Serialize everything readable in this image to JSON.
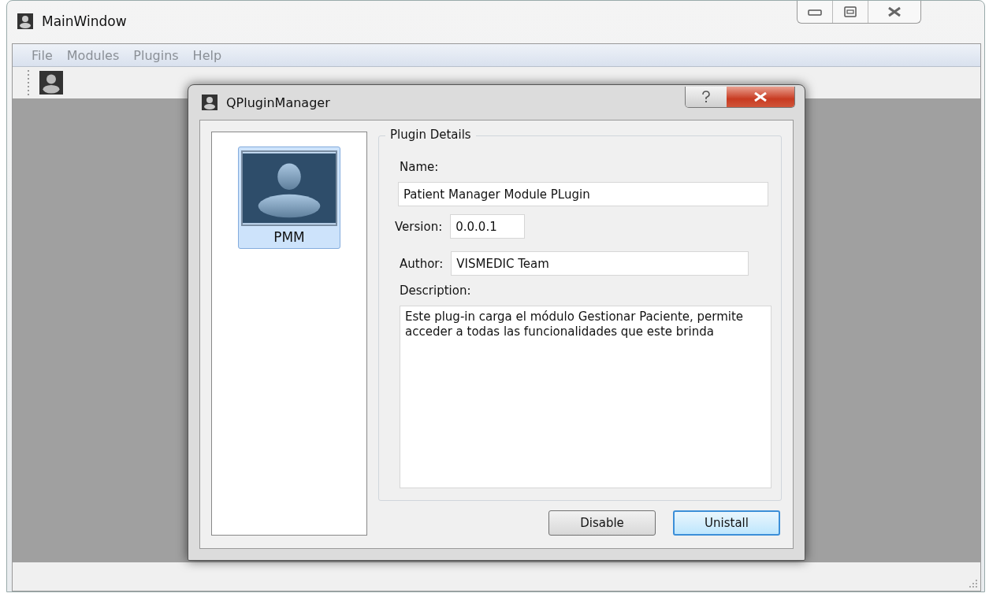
{
  "window": {
    "title": "MainWindow"
  },
  "menu": [
    "File",
    "Modules",
    "Plugins",
    "Help"
  ],
  "dialog": {
    "title": "QPluginManager",
    "plugins": [
      {
        "label": "PMM",
        "selected": true
      }
    ],
    "details": {
      "title": "Plugin Details",
      "name_label": "Name:",
      "name": "Patient Manager Module PLugin",
      "version_label": "Version:",
      "version": "0.0.0.1",
      "author_label": "Author:",
      "author": "VISMEDIC Team",
      "description_label": "Description:",
      "description": "Este plug-in carga el módulo Gestionar Paciente, permite acceder a todas las funcionalidades que este brinda"
    },
    "buttons": [
      {
        "label": "Disable",
        "default": false
      },
      {
        "label": "Unistall",
        "default": true
      }
    ]
  }
}
